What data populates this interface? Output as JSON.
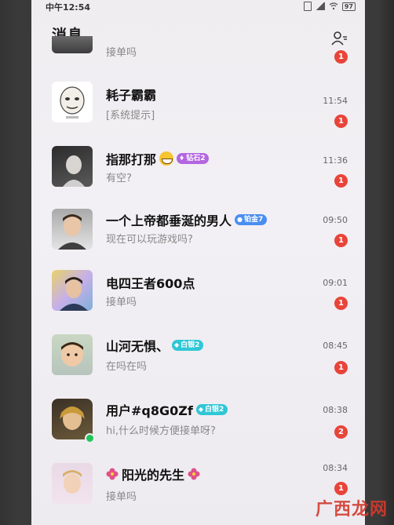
{
  "status_bar": {
    "time": "中午12:54",
    "battery": "97"
  },
  "header": {
    "title": "消息"
  },
  "conversations": [
    {
      "name": "",
      "preview": "接单吗",
      "time": "",
      "unread": "1"
    },
    {
      "name": "耗子霸霸",
      "preview": "[系统提示]",
      "time": "11:54",
      "unread": "1"
    },
    {
      "name": "指那打那",
      "preview": "有空?",
      "time": "11:36",
      "unread": "1",
      "badge": "钻石2",
      "badge_color": "#b366e0"
    },
    {
      "name": "一个上帝都垂涎的男人",
      "preview": "现在可以玩游戏吗?",
      "time": "09:50",
      "unread": "1",
      "badge": "铂金7",
      "badge_color": "#4a8ef0"
    },
    {
      "name": "电四王者600点",
      "preview": "接单吗",
      "time": "09:01",
      "unread": "1"
    },
    {
      "name": "山河无惧、",
      "preview": "在吗在吗",
      "time": "08:45",
      "unread": "1",
      "badge": "白银2",
      "badge_color": "#2fc7d6"
    },
    {
      "name": "用户#q8G0Zf",
      "preview": "hi,什么时候方便接单呀?",
      "time": "08:38",
      "unread": "2",
      "badge": "白银2",
      "badge_color": "#2fc7d6"
    },
    {
      "name": "阳光的先生",
      "preview": "接单吗",
      "time": "08:34",
      "unread": "1"
    }
  ],
  "watermark": "广西龙网",
  "colors": {
    "unread_badge": "#e8443a",
    "online_dot": "#1fc55a"
  }
}
